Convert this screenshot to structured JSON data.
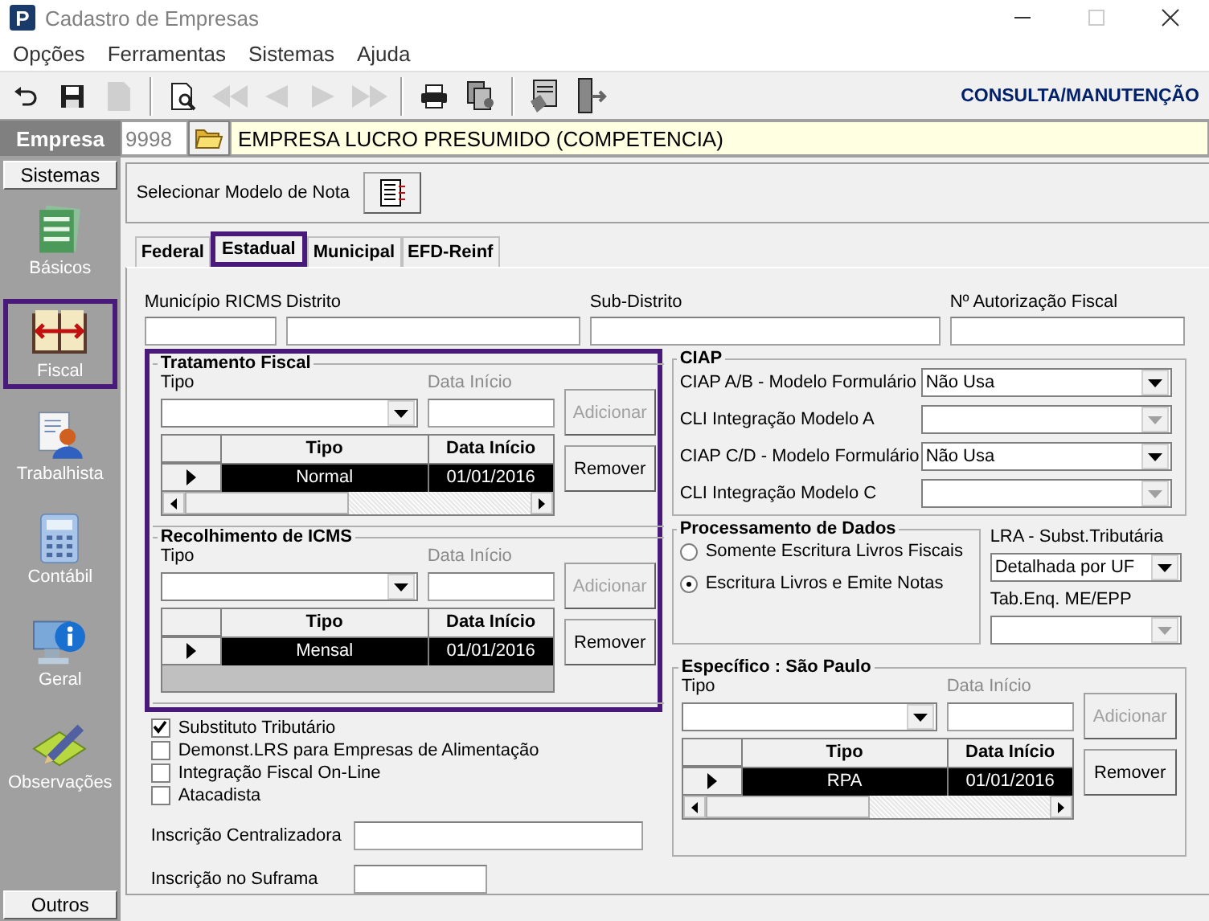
{
  "window": {
    "app_icon": "P",
    "title": "Cadastro de Empresas",
    "maximize_disabled": true
  },
  "menu": [
    "Opções",
    "Ferramentas",
    "Sistemas",
    "Ajuda"
  ],
  "toolbar": {
    "groups": [
      [
        {
          "kind": "undo",
          "disabled": false
        },
        {
          "kind": "save",
          "disabled": false
        },
        {
          "kind": "document",
          "disabled": true
        }
      ],
      [
        {
          "kind": "preview",
          "disabled": false
        },
        {
          "kind": "first",
          "disabled": true
        },
        {
          "kind": "previous",
          "disabled": true
        },
        {
          "kind": "next",
          "disabled": true
        },
        {
          "kind": "last",
          "disabled": true
        }
      ],
      [
        {
          "kind": "print",
          "disabled": false
        },
        {
          "kind": "report",
          "disabled": false
        }
      ],
      [
        {
          "kind": "stamp",
          "disabled": false
        },
        {
          "kind": "exit",
          "disabled": false
        }
      ]
    ],
    "mode": "CONSULTA/MANUTENÇÃO"
  },
  "empresa": {
    "label": "Empresa",
    "code": "9998",
    "name": "EMPRESA LUCRO PRESUMIDO (COMPETENCIA)"
  },
  "sidebar": {
    "header": "Sistemas",
    "footer": "Outros",
    "items": [
      {
        "label": "Básicos",
        "kind": "form",
        "selected": false
      },
      {
        "label": "Fiscal",
        "kind": "book",
        "selected": true
      },
      {
        "label": "Trabalhista",
        "kind": "person",
        "selected": false
      },
      {
        "label": "Contábil",
        "kind": "calculator",
        "selected": false
      },
      {
        "label": "Geral",
        "kind": "info",
        "selected": false
      },
      {
        "label": "Observações",
        "kind": "pencil",
        "selected": false
      }
    ]
  },
  "model_selector": {
    "label": "Selecionar Modelo de Nota"
  },
  "tabs": [
    {
      "label": "Federal",
      "selected": false
    },
    {
      "label": "Estadual",
      "selected": true
    },
    {
      "label": "Municipal",
      "selected": false
    },
    {
      "label": "EFD-Reinf",
      "selected": false
    }
  ],
  "top_fields": [
    {
      "label": "Município RICMS"
    },
    {
      "label": "Distrito"
    },
    {
      "label": "Sub-Distrito"
    },
    {
      "label": "Nº Autorização Fiscal"
    }
  ],
  "groups": [
    {
      "title": "Tratamento Fiscal",
      "type_label": "Tipo",
      "date_label": "Data Início",
      "date_disabled": true,
      "add_button": "Adicionar",
      "add_disabled": true,
      "remove_button": "Remover",
      "columns": [
        "Tipo",
        "Data Início"
      ],
      "rows": [
        {
          "tipo": "Normal",
          "data": "01/01/2016",
          "selected": true
        }
      ],
      "horizontal_scrollbar": true
    },
    {
      "title": "Recolhimento de ICMS",
      "type_label": "Tipo",
      "date_label": "Data Início",
      "date_disabled": true,
      "add_button": "Adicionar",
      "add_disabled": true,
      "remove_button": "Remover",
      "columns": [
        "Tipo",
        "Data Início"
      ],
      "rows": [
        {
          "tipo": "Mensal",
          "data": "01/01/2016",
          "selected": true
        }
      ],
      "horizontal_scrollbar": false
    }
  ],
  "checkboxes": [
    {
      "label": "Substituto Tributário",
      "checked": true
    },
    {
      "label": "Demonst.LRS para Empresas de Alimentação",
      "checked": false
    },
    {
      "label": "Integração Fiscal On-Line",
      "checked": false
    },
    {
      "label": "Atacadista",
      "checked": false
    }
  ],
  "inscricoes": [
    {
      "label": "Inscrição Centralizadora"
    },
    {
      "label": "Inscrição no Suframa"
    }
  ],
  "ciap": {
    "title": "CIAP",
    "rows": [
      {
        "label": "CIAP  A/B - Modelo Formulário",
        "value": "Não Usa",
        "disabled": false
      },
      {
        "label": "CLI Integração Modelo A",
        "disabled": true
      },
      {
        "label": "CIAP C/D - Modelo Formulário",
        "value": "Não Usa",
        "disabled": false
      },
      {
        "label": "CLI Integração Modelo C",
        "disabled": true
      }
    ]
  },
  "processamento": {
    "title": "Processamento de Dados",
    "options": [
      {
        "label": "Somente Escritura Livros Fiscais",
        "selected": false
      },
      {
        "label": "Escritura Livros e Emite Notas",
        "selected": true
      }
    ]
  },
  "lra": {
    "label": "LRA - Subst.Tributária",
    "value": "Detalhada por UF",
    "disabled": false
  },
  "tab_enq": {
    "label": "Tab.Enq. ME/EPP",
    "disabled": true
  },
  "especifico": {
    "title": "Específico : São Paulo",
    "type_label": "Tipo",
    "date_label": "Data Início",
    "date_disabled": true,
    "add_button": "Adicionar",
    "add_disabled": true,
    "remove_button": "Remover",
    "columns": [
      "Tipo",
      "Data Início"
    ],
    "rows": [
      {
        "tipo": "RPA",
        "data": "01/01/2016",
        "selected": true
      }
    ],
    "horizontal_scrollbar": true
  }
}
